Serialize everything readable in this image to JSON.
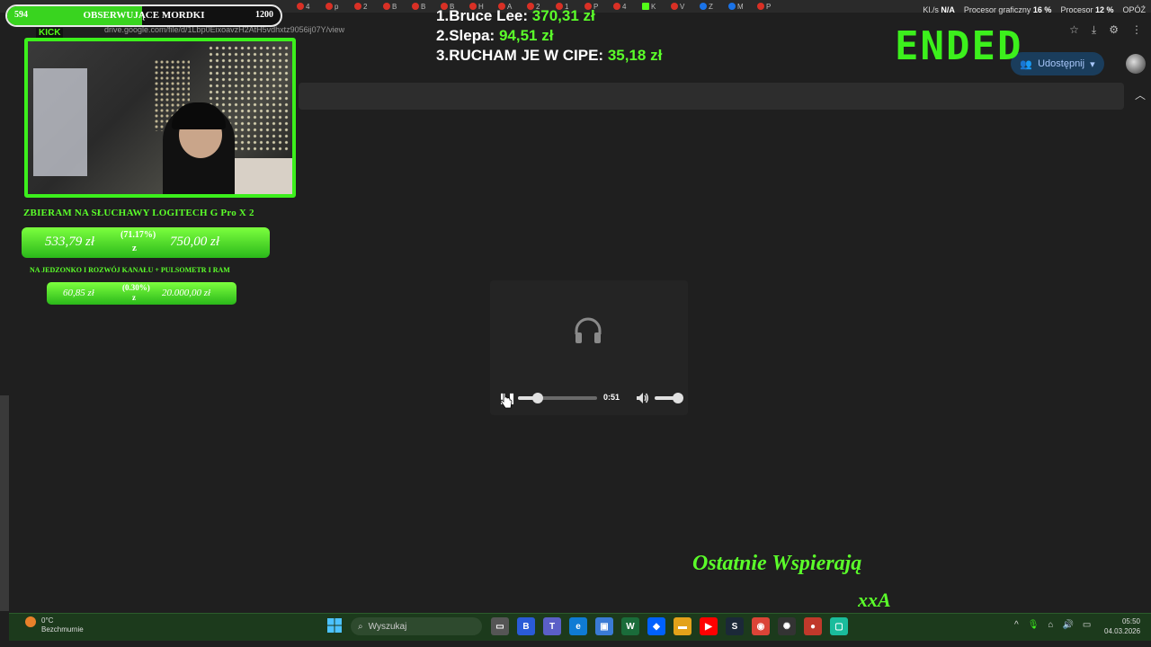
{
  "browser": {
    "url": "drive.google.com/file/d/1Lbp0EixoavzH2AtH5vdhxtz9056ij07Y/view",
    "tab_letters": [
      "4",
      "p",
      "2",
      "B",
      "B",
      "B",
      "H",
      "A",
      "2",
      "1",
      "P",
      "4",
      "K",
      "V",
      "Z",
      "M",
      "P"
    ],
    "share_label": "Udostępnij"
  },
  "stats": {
    "kl_label": "Kl./s",
    "kl_value": "N/A",
    "gpu_label": "Procesor graficzny",
    "gpu_value": "16 %",
    "cpu_label": "Procesor",
    "cpu_value": "12 %",
    "delay_label": "OPÓŹ"
  },
  "overlay": {
    "follower_bar": {
      "current": "594",
      "title": "OBSERWUJĄCE MORDKI",
      "target": "1200",
      "progress": 0.495
    },
    "kick_label": "KICK",
    "goal1": {
      "title": "ZBIERAM NA SŁUCHAWY LOGITECH G Pro X 2",
      "current": "533,79 zł",
      "percent": "(71.17%)",
      "z": "z",
      "target": "750,00 zł"
    },
    "goal2": {
      "title": "NA JEDZONKO I ROZWÓJ KANAŁU + PULSOMETR I RAM",
      "current": "60,85 zł",
      "percent": "(0.30%)",
      "z": "z",
      "target": "20.000,00 zł"
    },
    "leaderboard": [
      {
        "rank": "1.",
        "name": "Bruce Lee:",
        "amount": "370,31 zł"
      },
      {
        "rank": "2.",
        "name": "Slepa:",
        "amount": "94,51 zł"
      },
      {
        "rank": "3.",
        "name": "RUCHAM JE W CIPE:",
        "amount": "35,18 zł"
      }
    ],
    "ended": "ENDED",
    "supporters_title": "Ostatnie Wspierają",
    "supporters_name": "xxA"
  },
  "player": {
    "time": "0:51",
    "progress": 0.25,
    "volume": 0.8
  },
  "taskbar": {
    "weather_temp": "0°C",
    "weather_desc": "Bezchmurnie",
    "search_placeholder": "Wyszukaj",
    "time": "05:50",
    "date": "04.03.2026"
  },
  "colors": {
    "accent_green": "#5bff2a",
    "frame_green": "#3cf01c",
    "share_bg": "#1a3d5c"
  }
}
